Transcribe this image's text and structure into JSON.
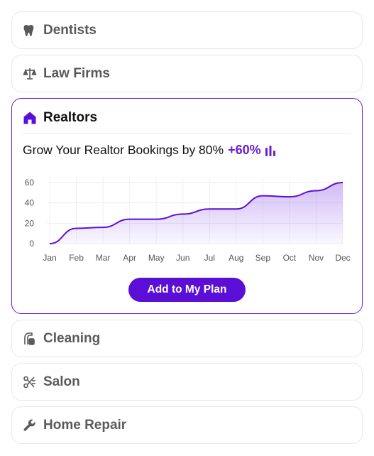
{
  "categories": [
    {
      "id": "dentists",
      "label": "Dentists",
      "icon": "tooth-icon"
    },
    {
      "id": "law-firms",
      "label": "Law Firms",
      "icon": "scales-icon"
    },
    {
      "id": "realtors",
      "label": "Realtors",
      "icon": "house-icon",
      "expanded": true
    },
    {
      "id": "cleaning",
      "label": "Cleaning",
      "icon": "spray-bottle-icon"
    },
    {
      "id": "salon",
      "label": "Salon",
      "icon": "scissors-icon"
    },
    {
      "id": "home-repair",
      "label": "Home Repair",
      "icon": "wrench-icon"
    }
  ],
  "realtors_panel": {
    "headline": "Grow Your Realtor Bookings by 80%",
    "delta": "+60%",
    "cta_label": "Add to My Plan"
  },
  "colors": {
    "accent": "#5b0fd6",
    "accent_line": "#6a1fd1",
    "card_border": "#e7e7ee",
    "muted_text": "#5a5a5a"
  },
  "chart_data": {
    "type": "area",
    "categories": [
      "Jan",
      "Feb",
      "Mar",
      "Apr",
      "May",
      "Jun",
      "Jul",
      "Aug",
      "Sep",
      "Oct",
      "Nov",
      "Dec"
    ],
    "values": [
      0,
      15,
      16,
      24,
      24,
      29,
      34,
      34,
      47,
      46,
      52,
      60
    ],
    "yticks": [
      0,
      20,
      40,
      60
    ],
    "ylim": [
      0,
      60
    ],
    "grid": true,
    "title": "",
    "xlabel": "",
    "ylabel": ""
  }
}
